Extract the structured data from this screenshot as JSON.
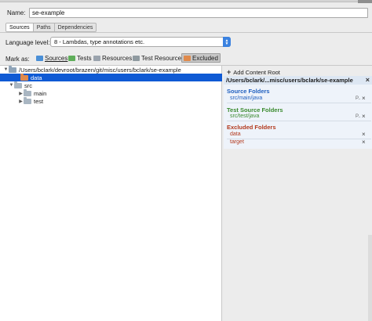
{
  "name_field": {
    "label": "Name:",
    "value": "se-example"
  },
  "tabs": [
    {
      "label": "Sources",
      "active": true
    },
    {
      "label": "Paths",
      "active": false
    },
    {
      "label": "Dependencies",
      "active": false
    }
  ],
  "language_level": {
    "label": "Language level:",
    "value": "8 - Lambdas, type annotations etc."
  },
  "mark_as": {
    "label": "Mark as:",
    "buttons": [
      {
        "label": "Sources",
        "color": "#4a8fd6"
      },
      {
        "label": "Tests",
        "color": "#5fae5a"
      },
      {
        "label": "Resources",
        "color": "#9aa3ad"
      },
      {
        "label": "Test Resources",
        "color": "#8f9aa0"
      },
      {
        "label": "Excluded",
        "color": "#e08a4c"
      }
    ]
  },
  "tree": {
    "root": "/Users/bclark/devroot/brazen/git/misc/users/bclark/se-example",
    "items": [
      {
        "label": "data",
        "selected": true
      },
      {
        "label": "src"
      },
      {
        "label": "main"
      },
      {
        "label": "test"
      }
    ]
  },
  "right_panel": {
    "add_content_root": "Add Content Root",
    "root_path": "/Users/bclark/...misc/users/bclark/se-example",
    "source_folders": {
      "title": "Source Folders",
      "color": "#1f5fbf",
      "items": [
        "src/main/java"
      ]
    },
    "test_source_folders": {
      "title": "Test Source Folders",
      "color": "#3a8a2e",
      "items": [
        "src/test/java"
      ]
    },
    "excluded_folders": {
      "title": "Excluded Folders",
      "color": "#b33a1e",
      "items": [
        "data",
        "target"
      ]
    }
  },
  "icons": {
    "remove": "×",
    "properties": "P..",
    "expanded": "▼",
    "collapsed": "▶"
  }
}
